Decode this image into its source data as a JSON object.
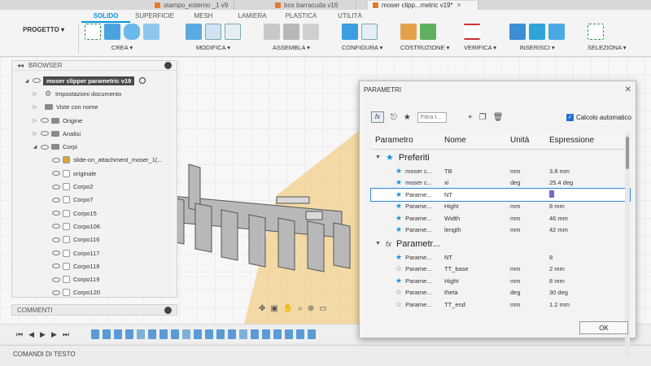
{
  "tabs": [
    {
      "label": "stampo_esterno _1 v9",
      "active": false
    },
    {
      "label": "box barracuda v16",
      "active": false
    },
    {
      "label": "moser clipp...metric v19*",
      "active": true
    }
  ],
  "ribbon": {
    "project_label": "PROGETTO",
    "tabs": [
      "SOLIDO",
      "SUPERFICIE",
      "MESH",
      "LAMIERA",
      "PLASTICA",
      "UTILITÀ"
    ],
    "groups": {
      "crea": "CREA",
      "modifica": "MODIFICA",
      "assembla": "ASSEMBLA",
      "configura": "CONFIGURA",
      "costruzione": "COSTRUZIONE",
      "verifica": "VERIFICA",
      "inserisci": "INSERISCI",
      "seleziona": "SELEZIONA"
    }
  },
  "browser": {
    "title": "BROWSER",
    "root": "moser clipper parametric v19",
    "items": [
      "Impostazioni documento",
      "Viste con nome",
      "Origine",
      "Analisi",
      "Corpi",
      "slide-on_attachment_moser_1(...",
      "originale",
      "Corpo2",
      "Corpo7",
      "Corpo15",
      "Corpo106",
      "Corpo116",
      "Corpo117",
      "Corpo118",
      "Corpo119",
      "Corpo120"
    ]
  },
  "comments_label": "COMMENTI",
  "text_commands_label": "COMANDI DI TESTO",
  "dialog": {
    "title": "PARAMETRI",
    "filter_placeholder": "Filtra t...",
    "auto_calc_label": "Calcolo automatico",
    "columns": [
      "Parametro",
      "Nome",
      "Unità",
      "Espressione"
    ],
    "group_favorites": "Preferiti",
    "group_model": "Parametr...",
    "favorites": [
      {
        "param": "moser c...",
        "name": "TB",
        "unit": "mm",
        "expr": "3.8 mm"
      },
      {
        "param": "moser c...",
        "name": "xi",
        "unit": "deg",
        "expr": "25.4 deg"
      },
      {
        "param": "Parame...",
        "name": "NT",
        "unit": "",
        "expr": ""
      },
      {
        "param": "Parame...",
        "name": "Hight",
        "unit": "mm",
        "expr": "8 mm"
      },
      {
        "param": "Parame...",
        "name": "Width",
        "unit": "mm",
        "expr": "46 mm"
      },
      {
        "param": "Parame...",
        "name": "length",
        "unit": "mm",
        "expr": "42 mm"
      }
    ],
    "model": [
      {
        "param": "Parame...",
        "name": "NT",
        "unit": "",
        "expr": "8"
      },
      {
        "param": "Parame...",
        "name": "TT_base",
        "unit": "mm",
        "expr": "2 mm"
      },
      {
        "param": "Parame...",
        "name": "Hight",
        "unit": "mm",
        "expr": "8 mm"
      },
      {
        "param": "Parame...",
        "name": "theta",
        "unit": "deg",
        "expr": "30 deg"
      },
      {
        "param": "Parame...",
        "name": "TT_end",
        "unit": "mm",
        "expr": "1.2 mm"
      }
    ],
    "ok_label": "OK"
  }
}
